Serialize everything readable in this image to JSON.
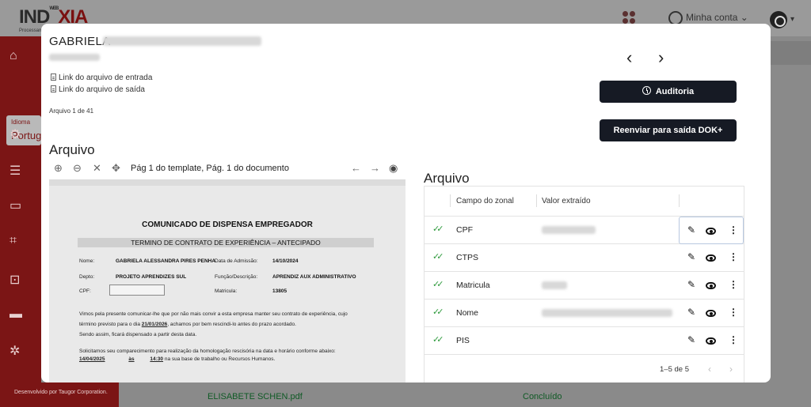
{
  "app": {
    "logo": {
      "text_left": "IND",
      "text_badge": "WEB",
      "text_right": "XIA",
      "subtitle": "Processam"
    },
    "header": {
      "account_label": "Minha conta"
    },
    "sidebar": {
      "language_label": "Idioma",
      "language_value": "Portugu",
      "credit": "Desenvolvido por Taugor Corporation."
    },
    "background_row": {
      "filename": "ELISABETE SCHEN.pdf",
      "status": "Concluído"
    }
  },
  "modal": {
    "title": "GABRIELA",
    "links": {
      "input": "Link do arquivo de entrada",
      "output": "Link do arquivo de saída"
    },
    "file_counter": "Arquivo 1 de 41",
    "nav": {
      "prev": "‹",
      "next": "›"
    },
    "buttons": {
      "audit": "Auditoria",
      "resend": "Reenviar para saída DOK+"
    },
    "viewer": {
      "title": "Arquivo",
      "page_label": "Pág 1 do template, Pág. 1 do documento",
      "document": {
        "heading": "COMUNICADO DE DISPENSA EMPREGADOR",
        "band": "TERMINO DE CONTRATO DE EXPERIÊNCIA – ANTECIPADO",
        "rows": {
          "name_label": "Nome:",
          "name_value": "GABRIELA ALESSANDRA PIRES PENHA",
          "admission_label": "Data de Admissão:",
          "admission_value": "14/10/2024",
          "dept_label": "Depto:",
          "dept_value": "PROJETO APRENDIZES SUL",
          "role_label": "Função/Descrição:",
          "role_value": "APRENDIZ AUX ADMINISTRATIVO",
          "cpf_label": "CPF:",
          "registration_label": "Matricula:",
          "registration_value": "13805"
        },
        "paragraphs": {
          "p1a": "Vimos pela presente comunicar-lhe que por não mais convir a esta empresa manter seu contrato de experiência, cujo",
          "p1b_pre": "término previsto para o dia ",
          "p1b_date": "21/01/2026",
          "p1b_post": ", achamos por bem rescindi-lo antes do prazo acordado.",
          "p2": "Sendo assim, ficará dispensado a partir desta data.",
          "p3": "Solicitamos seu comparecimento para realização da homologação rescisória na data e horário conforme abaixo:",
          "p4_date": "14/04/2025",
          "p4_at": "às",
          "p4_time": "14:30",
          "p4_rest": "na sua base de trabalho ou Recursos Humanos."
        }
      }
    },
    "fields": {
      "title": "Arquivo",
      "headers": {
        "field": "Campo do zonal",
        "value": "Valor extraído"
      },
      "rows": [
        {
          "name": "CPF",
          "has_value": true
        },
        {
          "name": "CTPS",
          "has_value": false
        },
        {
          "name": "Matricula",
          "has_value": true
        },
        {
          "name": "Nome",
          "has_value": true
        },
        {
          "name": "PIS",
          "has_value": false
        }
      ],
      "pagination": "1–5 de 5"
    }
  }
}
